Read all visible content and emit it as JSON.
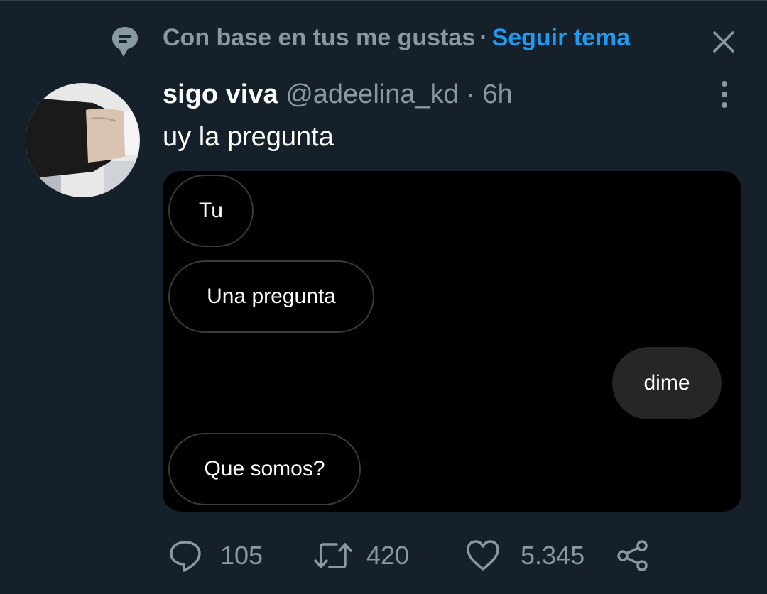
{
  "context": {
    "text": "Con base en tus me gustas",
    "separator": "·",
    "follow_label": "Seguir tema"
  },
  "tweet": {
    "display_name": "sigo viva",
    "handle": "@adeelina_kd",
    "dot": "·",
    "time": "6h",
    "text": "uy la pregunta",
    "media": {
      "messages": [
        {
          "text": "Tu",
          "side": "received"
        },
        {
          "text": "Una pregunta",
          "side": "received"
        },
        {
          "text": "dime",
          "side": "sent"
        },
        {
          "text": "Que somos?",
          "side": "received"
        }
      ]
    }
  },
  "actions": {
    "replies": "105",
    "retweets": "420",
    "likes": "5.345"
  },
  "icons": {
    "context": "topic-bubble-icon",
    "close": "close-icon",
    "more": "more-vertical-icon",
    "reply": "reply-icon",
    "retweet": "retweet-icon",
    "like": "heart-icon",
    "share": "share-icon"
  },
  "colors": {
    "background": "#15202b",
    "secondary_text": "#8899a6",
    "accent": "#1d9bf0"
  }
}
